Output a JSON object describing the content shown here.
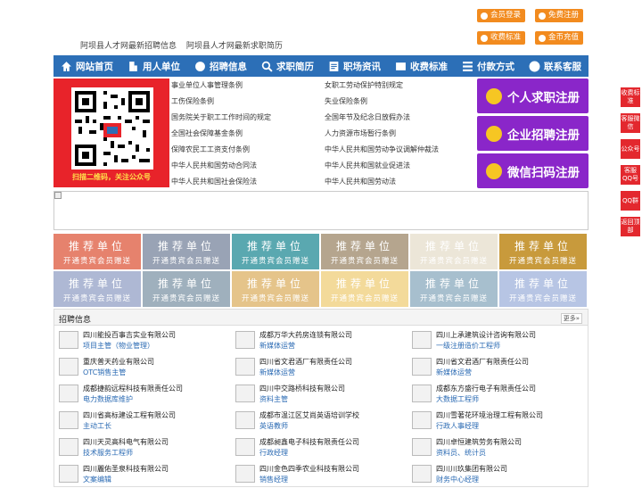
{
  "header": {
    "slogan": [
      "阿坝县人才网最新招聘信息",
      "阿坝县人才网最新求职简历"
    ],
    "buttons": [
      "会员登录",
      "免费注册",
      "收费标准",
      "金币充值"
    ]
  },
  "nav": [
    "网站首页",
    "用人单位",
    "招聘信息",
    "求职简历",
    "职场资讯",
    "收费标准",
    "付款方式",
    "联系客服"
  ],
  "banner": {
    "qr_caption": "扫描二维码，关注公众号"
  },
  "laws": {
    "left": [
      "事业单位人事管理条例",
      "工伤保险条例",
      "国务院关于职工工作时间的规定",
      "全国社会保障基金条例",
      "保障农民工工资支付条例",
      "中华人民共和国劳动合同法",
      "中华人民共和国社会保险法"
    ],
    "right": [
      "女职工劳动保护特别规定",
      "失业保险条例",
      "全国年节及纪念日放假办法",
      "人力资源市场暂行条例",
      "中华人民共和国劳动争议调解仲裁法",
      "中华人民共和国就业促进法",
      "中华人民共和国劳动法"
    ]
  },
  "register": [
    "个人求职注册",
    "企业招聘注册",
    "微信扫码注册"
  ],
  "ads": {
    "title": "推荐单位",
    "sub": "开通贵宾会员赠送",
    "colors": [
      "#e6826d",
      "#99a3b5",
      "#5aa8b0",
      "#b5a58e",
      "#ece6d8",
      "#c89a3c",
      "#aeb8d4",
      "#9fb0bd",
      "#e5c48a",
      "#f3da9a",
      "#a7bfce",
      "#b7c5e4"
    ]
  },
  "jobs": {
    "title": "招聘信息",
    "more": "更多»",
    "list": [
      {
        "company": "四川能投百事吉实业有限公司",
        "position": "项目主管（物业管理）"
      },
      {
        "company": "成都万华大药房连锁有限公司",
        "position": "新媒体运营"
      },
      {
        "company": "四川上承建筑设计咨询有限公司",
        "position": "一级注册造价工程师"
      },
      {
        "company": "重庆普天药业有限公司",
        "position": "OTC销售主管"
      },
      {
        "company": "四川省文君酒厂有限责任公司",
        "position": "新媒体运营"
      },
      {
        "company": "四川省文君酒厂有限责任公司",
        "position": "新媒体运营"
      },
      {
        "company": "成都捷韵远程科技有限责任公司",
        "position": "电力数据库维护"
      },
      {
        "company": "四川中交路桥科技有限公司",
        "position": "资料主管"
      },
      {
        "company": "成都东方盛行电子有限责任公司",
        "position": "大数据工程师"
      },
      {
        "company": "四川省高标建设工程有限公司",
        "position": "主动工长"
      },
      {
        "company": "成都市温江区艾尚英语培训学校",
        "position": "英语教师"
      },
      {
        "company": "四川雪著花环境治理工程有限公司",
        "position": "行政人事经理"
      },
      {
        "company": "四川天灵高科电气有限公司",
        "position": "技术服务工程师"
      },
      {
        "company": "成都昶鑫电子科技有限责任公司",
        "position": "行政经理"
      },
      {
        "company": "四川卓恒建筑劳务有限公司",
        "position": "资料员、统计员"
      },
      {
        "company": "四川麗佑圣泉科技有限公司",
        "position": "文案编辑"
      },
      {
        "company": "四川金色四季农业科技有限公司",
        "position": "销售经理"
      },
      {
        "company": "四川川玖集团有限公司",
        "position": "财务中心经理"
      }
    ]
  },
  "side": [
    "收费标准",
    "客服微信",
    "公众号",
    "客服QQ号",
    "QQ群",
    "返回顶部"
  ]
}
